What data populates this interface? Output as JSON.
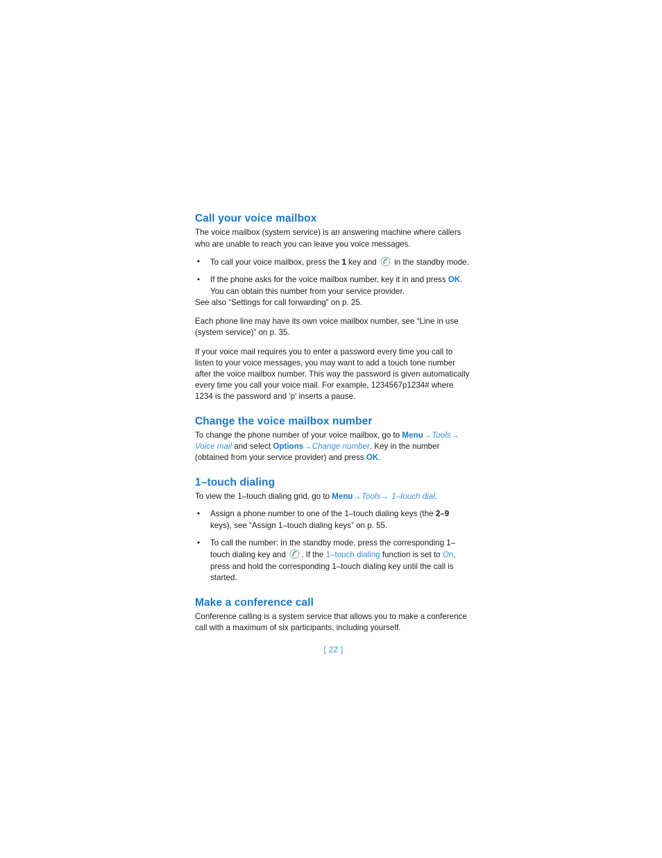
{
  "document": {
    "type": "user-guide-page",
    "page_number_label": "[ 22 ]",
    "heading_color": "#1878d2",
    "link_color": "#3a8fe0",
    "body_color": "#1c1c1c",
    "icon_color": "#2aa05a"
  },
  "sections": [
    {
      "id": "call-your-voice-mailbox",
      "heading": "Call your voice mailbox",
      "intro": "The voice mailbox (system service) is an answering machine where callers who are unable to reach you can leave you voice messages.",
      "bullets": [
        {
          "parts": {
            "a": "To call your voice mailbox, press the ",
            "key": "1",
            "b": " key and ",
            "icon": "call-key-icon",
            "c": " in the standby mode."
          }
        },
        {
          "parts": {
            "a": "If the phone asks for the voice mailbox number, key it in and press ",
            "ok": "OK",
            "b": ". You can obtain this number from your service provider."
          }
        }
      ],
      "paragraphs": [
        "See also “Settings for call forwarding” on p. 25.",
        "Each phone line may have its own voice mailbox number, see “Line in use (system service)” on p. 35.",
        "If your voice mail requires you to enter a password every time you call to listen to your voice messages, you may want to add a touch tone number after the voice mailbox number. This way the password is given automatically every time you call your voice mail. For example, 1234567p1234# where 1234 is the password and 'p' inserts a pause."
      ]
    },
    {
      "id": "change-the-voice-mailbox-number",
      "heading": "Change the voice mailbox number",
      "body": {
        "a": "To change the phone number of your voice mailbox, go to ",
        "menu": "Menu",
        "arrow1": "→",
        "tools": "Tools",
        "arrow2": "→",
        "b": " ",
        "voicemail": "Voice mail",
        "c": " and select ",
        "options": "Options",
        "arrow3": "→",
        "changenumber": "Change number",
        "d": ". Key in the number (obtained from your service provider) and press ",
        "ok": "OK",
        "e": "."
      }
    },
    {
      "id": "one-touch-dialing",
      "heading": "1–touch dialing",
      "body": {
        "a": "To view the 1–touch dialing grid, go to ",
        "menu": "Menu",
        "arrow1": "→",
        "tools": "Tools",
        "arrow2": "→",
        "onetouchdial": "1–touch dial",
        "b": "."
      },
      "bullets": [
        {
          "parts": {
            "a": "Assign a phone number to one of the 1–touch dialing keys (the ",
            "keys": "2–9",
            "b": " keys), see “Assign 1–touch dialing keys” on p. 55."
          }
        },
        {
          "parts": {
            "a": "To call the number: In the standby mode, press the corresponding 1–touch dialing key and ",
            "icon": "call-key-icon",
            "b": ". If the ",
            "feature": "1–touch dialing",
            "c": " function is set to ",
            "on": "On",
            "d": ", press and hold the corresponding 1–touch dialing key until the call is started."
          }
        }
      ]
    },
    {
      "id": "make-a-conference-call",
      "heading": "Make a conference call",
      "intro": "Conference calling is a system service that allows you to make a conference call with a maximum of six participants, including yourself."
    }
  ]
}
